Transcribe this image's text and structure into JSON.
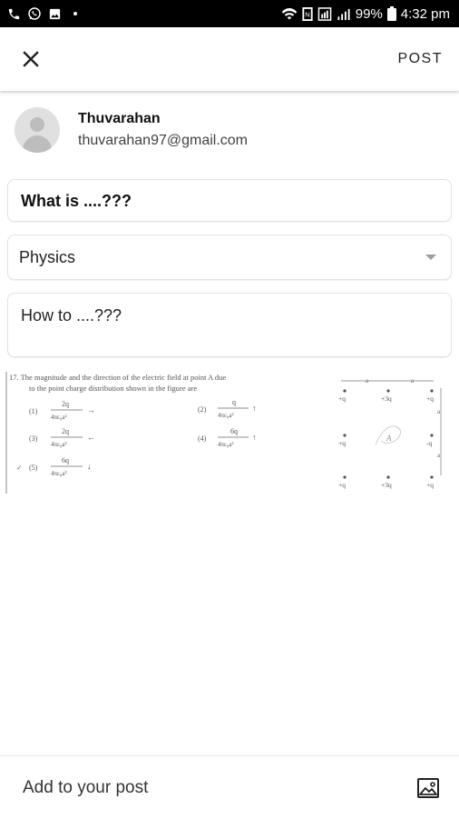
{
  "status_bar": {
    "battery": "99%",
    "time": "4:32 pm",
    "left_icons": [
      "phone-icon",
      "whatsapp-icon",
      "gallery-icon",
      "dot-icon"
    ],
    "right_icons": [
      "wifi-icon",
      "nfc-icon",
      "data-icon",
      "signal-icon",
      "battery-icon"
    ]
  },
  "appbar": {
    "close_icon": "close-icon",
    "post_label": "POST"
  },
  "user": {
    "name": "Thuvarahan",
    "email": "thuvarahan97@gmail.com"
  },
  "form": {
    "title_value": "What is ....???",
    "subject_value": "Physics",
    "description_value": "How to ....???"
  },
  "attachment": {
    "question_line1": "17.  The magnitude and the direction of the electric field at point A due",
    "question_line2": "to the point charge distribution shown in the figure are",
    "options": [
      {
        "num": "(1)",
        "numerator": "2q",
        "denominator": "4πε₀a²",
        "arrow": "→"
      },
      {
        "num": "(2)",
        "numerator": "q",
        "denominator": "4πε₀a²",
        "arrow": "↑"
      },
      {
        "num": "(3)",
        "numerator": "2q",
        "denominator": "4πε₀a²",
        "arrow": "←"
      },
      {
        "num": "(4)",
        "numerator": "6q",
        "denominator": "4πε₀a²",
        "arrow": "↑"
      },
      {
        "num": "(5)",
        "numerator": "6q",
        "denominator": "4πε₀a²",
        "arrow": "↓"
      }
    ],
    "charges": {
      "top": [
        "+q",
        "+3q",
        "+q"
      ],
      "middle": [
        "+q",
        "-q"
      ],
      "bottom": [
        "+q",
        "+3q",
        "+q"
      ],
      "point_label": "A",
      "spacing_label": "a"
    }
  },
  "bottom_bar": {
    "label": "Add to your post",
    "image_icon": "image-icon"
  }
}
